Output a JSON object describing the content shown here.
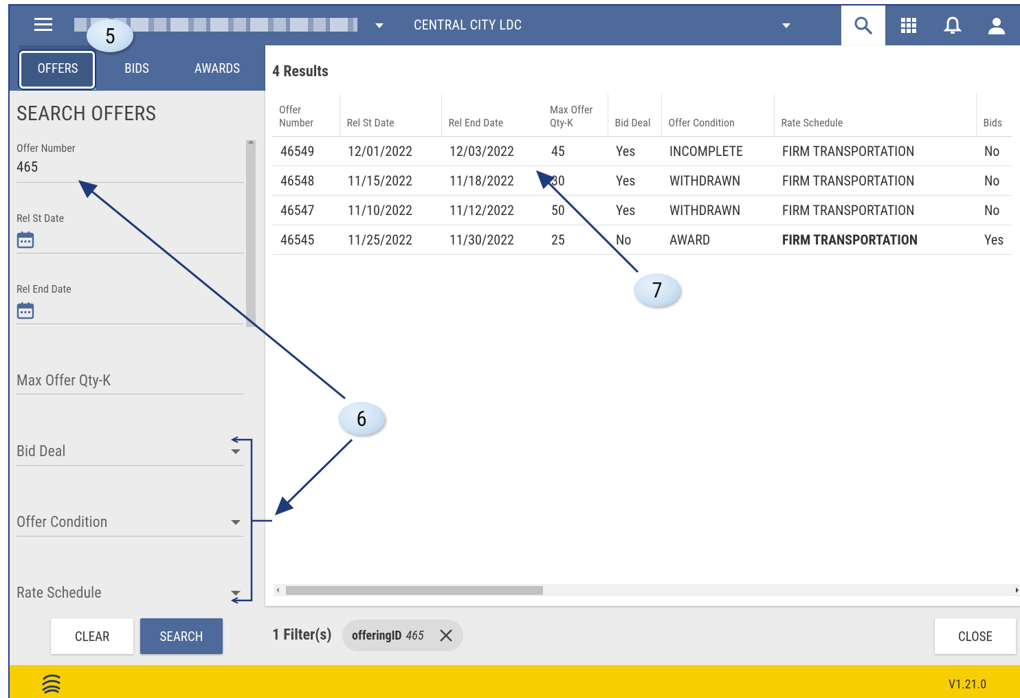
{
  "topbar": {
    "company": "CENTRAL CITY LDC",
    "icons": [
      "menu-icon",
      "search-icon",
      "apps-grid-icon",
      "bell-icon",
      "user-icon"
    ]
  },
  "tabs": [
    {
      "label": "OFFERS",
      "active": true
    },
    {
      "label": "BIDS",
      "active": false
    },
    {
      "label": "AWARDS",
      "active": false
    }
  ],
  "search_panel": {
    "title": "SEARCH OFFERS",
    "offer_number": {
      "label": "Offer Number",
      "value": "465"
    },
    "rel_st_date": {
      "label": "Rel St Date"
    },
    "rel_end_date": {
      "label": "Rel End Date"
    },
    "max_offer_qty": {
      "placeholder": "Max Offer Qty-K"
    },
    "bid_deal": {
      "placeholder": "Bid Deal"
    },
    "offer_condition": {
      "placeholder": "Offer Condition"
    },
    "rate_schedule": {
      "placeholder": "Rate Schedule"
    },
    "clear_label": "CLEAR",
    "search_label": "SEARCH"
  },
  "results": {
    "count_label": "4 Results",
    "columns": [
      {
        "line1": "Offer",
        "line2": "Number"
      },
      {
        "line1": "",
        "line2": "Rel St Date"
      },
      {
        "line1": "",
        "line2": "Rel End Date"
      },
      {
        "line1": "Max Offer",
        "line2": "Qty-K"
      },
      {
        "line1": "",
        "line2": "Bid Deal"
      },
      {
        "line1": "",
        "line2": "Offer Condition"
      },
      {
        "line1": "",
        "line2": "Rate Schedule"
      },
      {
        "line1": "",
        "line2": "Bids"
      }
    ],
    "rows": [
      [
        "46549",
        "12/01/2022",
        "12/03/2022",
        "45",
        "Yes",
        "INCOMPLETE",
        "FIRM TRANSPORTATION",
        "No"
      ],
      [
        "46548",
        "11/15/2022",
        "11/18/2022",
        "30",
        "Yes",
        "WITHDRAWN",
        "FIRM TRANSPORTATION",
        "No"
      ],
      [
        "46547",
        "11/10/2022",
        "11/12/2022",
        "50",
        "Yes",
        "WITHDRAWN",
        "FIRM TRANSPORTATION",
        "No"
      ],
      [
        "46545",
        "11/25/2022",
        "11/30/2022",
        "25",
        "No",
        "AWARD",
        "FIRM TRANSPORTATION",
        "Yes"
      ]
    ]
  },
  "filters": {
    "label": "1 Filter(s)",
    "chip_key": "offeringID",
    "chip_value": "465"
  },
  "close_label": "CLOSE",
  "footer": {
    "version": "V1.21.0"
  },
  "callouts": [
    "5",
    "6",
    "7"
  ],
  "colors": {
    "header": "#4e6a9a",
    "footer": "#f7cf00",
    "annotation": "#1e3a7a"
  }
}
